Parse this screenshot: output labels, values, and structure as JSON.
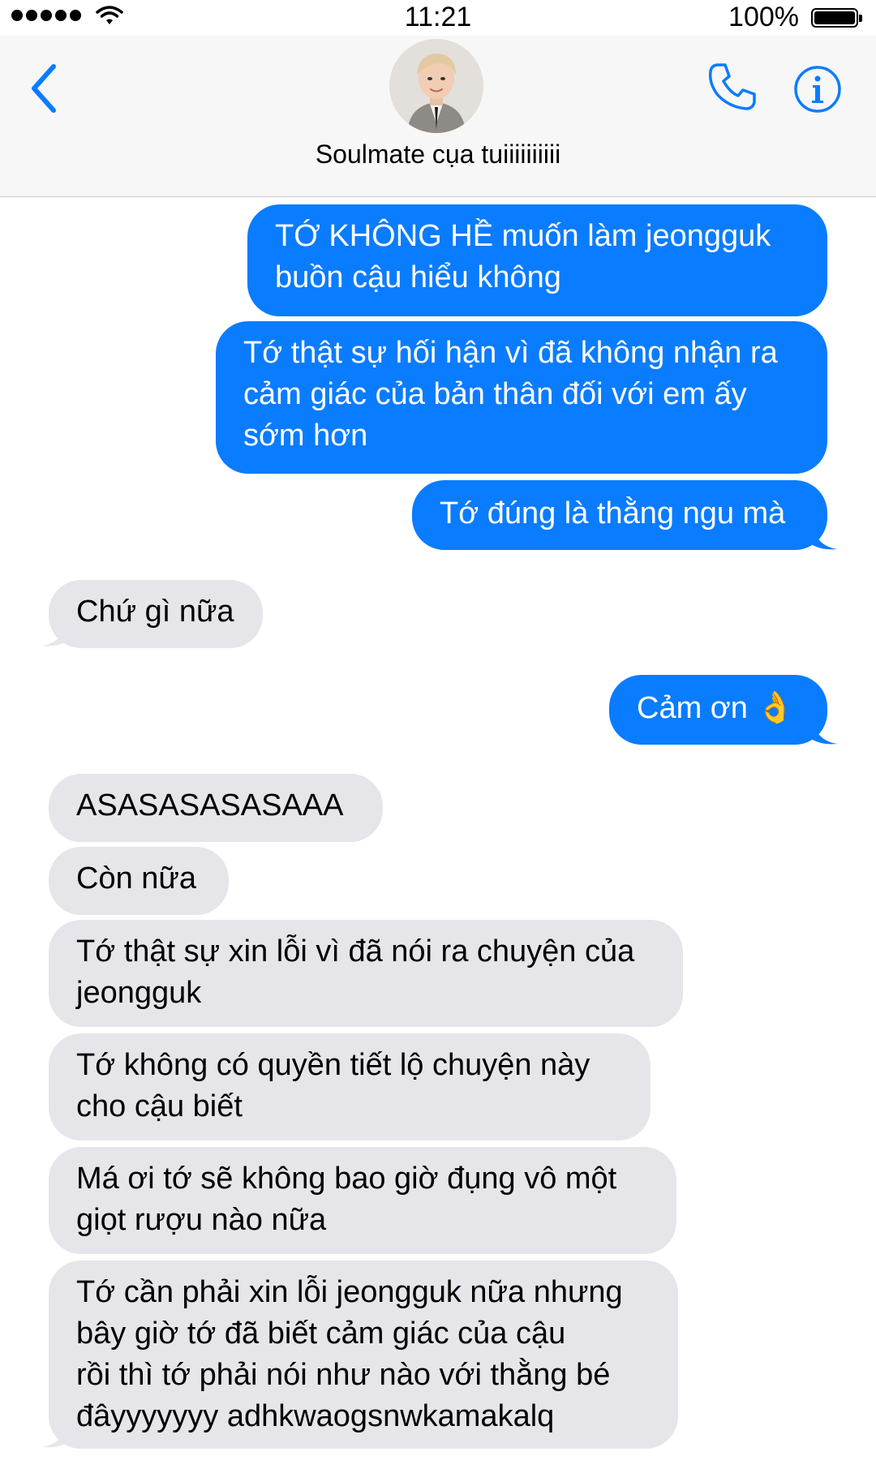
{
  "status_bar": {
    "time": "11:21",
    "battery_percent": "100%",
    "signal_bars": 5
  },
  "header": {
    "contact_name": "Soulmate cụa tuiiiiiiiiii",
    "icons": [
      "back-chevron-icon",
      "phone-icon",
      "info-icon"
    ],
    "accent_color": "#0a7cff"
  },
  "messages": [
    {
      "from": "me",
      "text": "TỚ KHÔNG HỀ muốn làm jeongguk\nbuồn cậu hiểu không"
    },
    {
      "from": "me",
      "text": "Tớ thật sự hối hận vì đã không nhận ra\ncảm giác của bản thân đối với em ấy\nsớm hơn"
    },
    {
      "from": "me",
      "text": "Tớ đúng là thằng ngu mà"
    },
    {
      "from": "them",
      "text": "Chứ gì nữa"
    },
    {
      "from": "me",
      "text": "Cảm ơn 👌"
    },
    {
      "from": "them",
      "text": "ASASASASASAAA"
    },
    {
      "from": "them",
      "text": "Còn nữa"
    },
    {
      "from": "them",
      "text": "Tớ thật sự xin lỗi vì đã nói ra chuyện của\njeongguk"
    },
    {
      "from": "them",
      "text": "Tớ không có quyền tiết lộ chuyện này\ncho cậu biết"
    },
    {
      "from": "them",
      "text": "Má ơi tớ sẽ không bao giờ đụng vô một\ngiọt rượu nào nữa"
    },
    {
      "from": "them",
      "text": "Tớ cần phải xin lỗi jeongguk nữa nhưng\nbây giờ tớ đã biết cảm giác của cậu\nrồi thì tớ phải nói như nào với thằng bé\nđâyyyyyyy adhkwaogsnwkamakalq"
    }
  ],
  "colors": {
    "sent_bubble": "#0a7cff",
    "received_bubble": "#e5e5ea"
  }
}
